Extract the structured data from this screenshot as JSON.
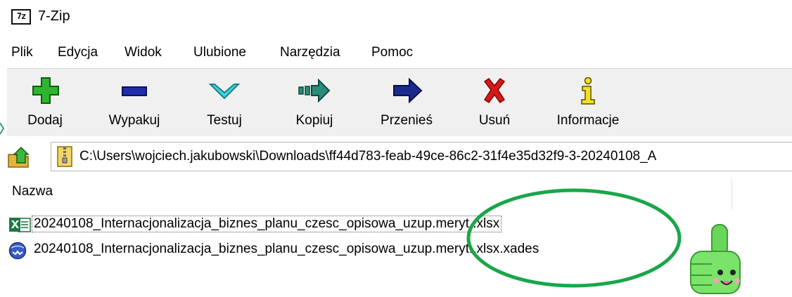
{
  "window": {
    "title": "7-Zip",
    "icon_text": "7z"
  },
  "menu": [
    "Plik",
    "Edycja",
    "Widok",
    "Ulubione",
    "Narzędzia",
    "Pomoc"
  ],
  "toolbar": {
    "add": "Dodaj",
    "extract": "Wypakuj",
    "test": "Testuj",
    "copy": "Kopiuj",
    "move": "Przenieś",
    "delete": "Usuń",
    "info": "Informacje"
  },
  "address": {
    "path": "C:\\Users\\wojciech.jakubowski\\Downloads\\ff44d783-feab-49ce-86c2-31f4e35d32f9-3-20240108_A"
  },
  "filelist": {
    "column_name": "Nazwa",
    "files": [
      {
        "name": "20240108_Internacjonalizacja_biznes_planu_czesc_opisowa_uzup.meryt..xlsx",
        "icon": "excel-file-icon"
      },
      {
        "name": "20240108_Internacjonalizacja_biznes_planu_czesc_opisowa_uzup.meryt..xlsx.xades",
        "icon": "xades-file-icon"
      }
    ]
  },
  "colors": {
    "add_green": "#2fb52f",
    "extract_blue": "#1f2fa8",
    "test_cyan": "#3fd6e0",
    "copy_teal": "#2a8c7a",
    "move_navy": "#1a2a8c",
    "delete_red": "#d81818",
    "info_yellow": "#f2e21a",
    "highlight_green": "#1aa64a"
  }
}
